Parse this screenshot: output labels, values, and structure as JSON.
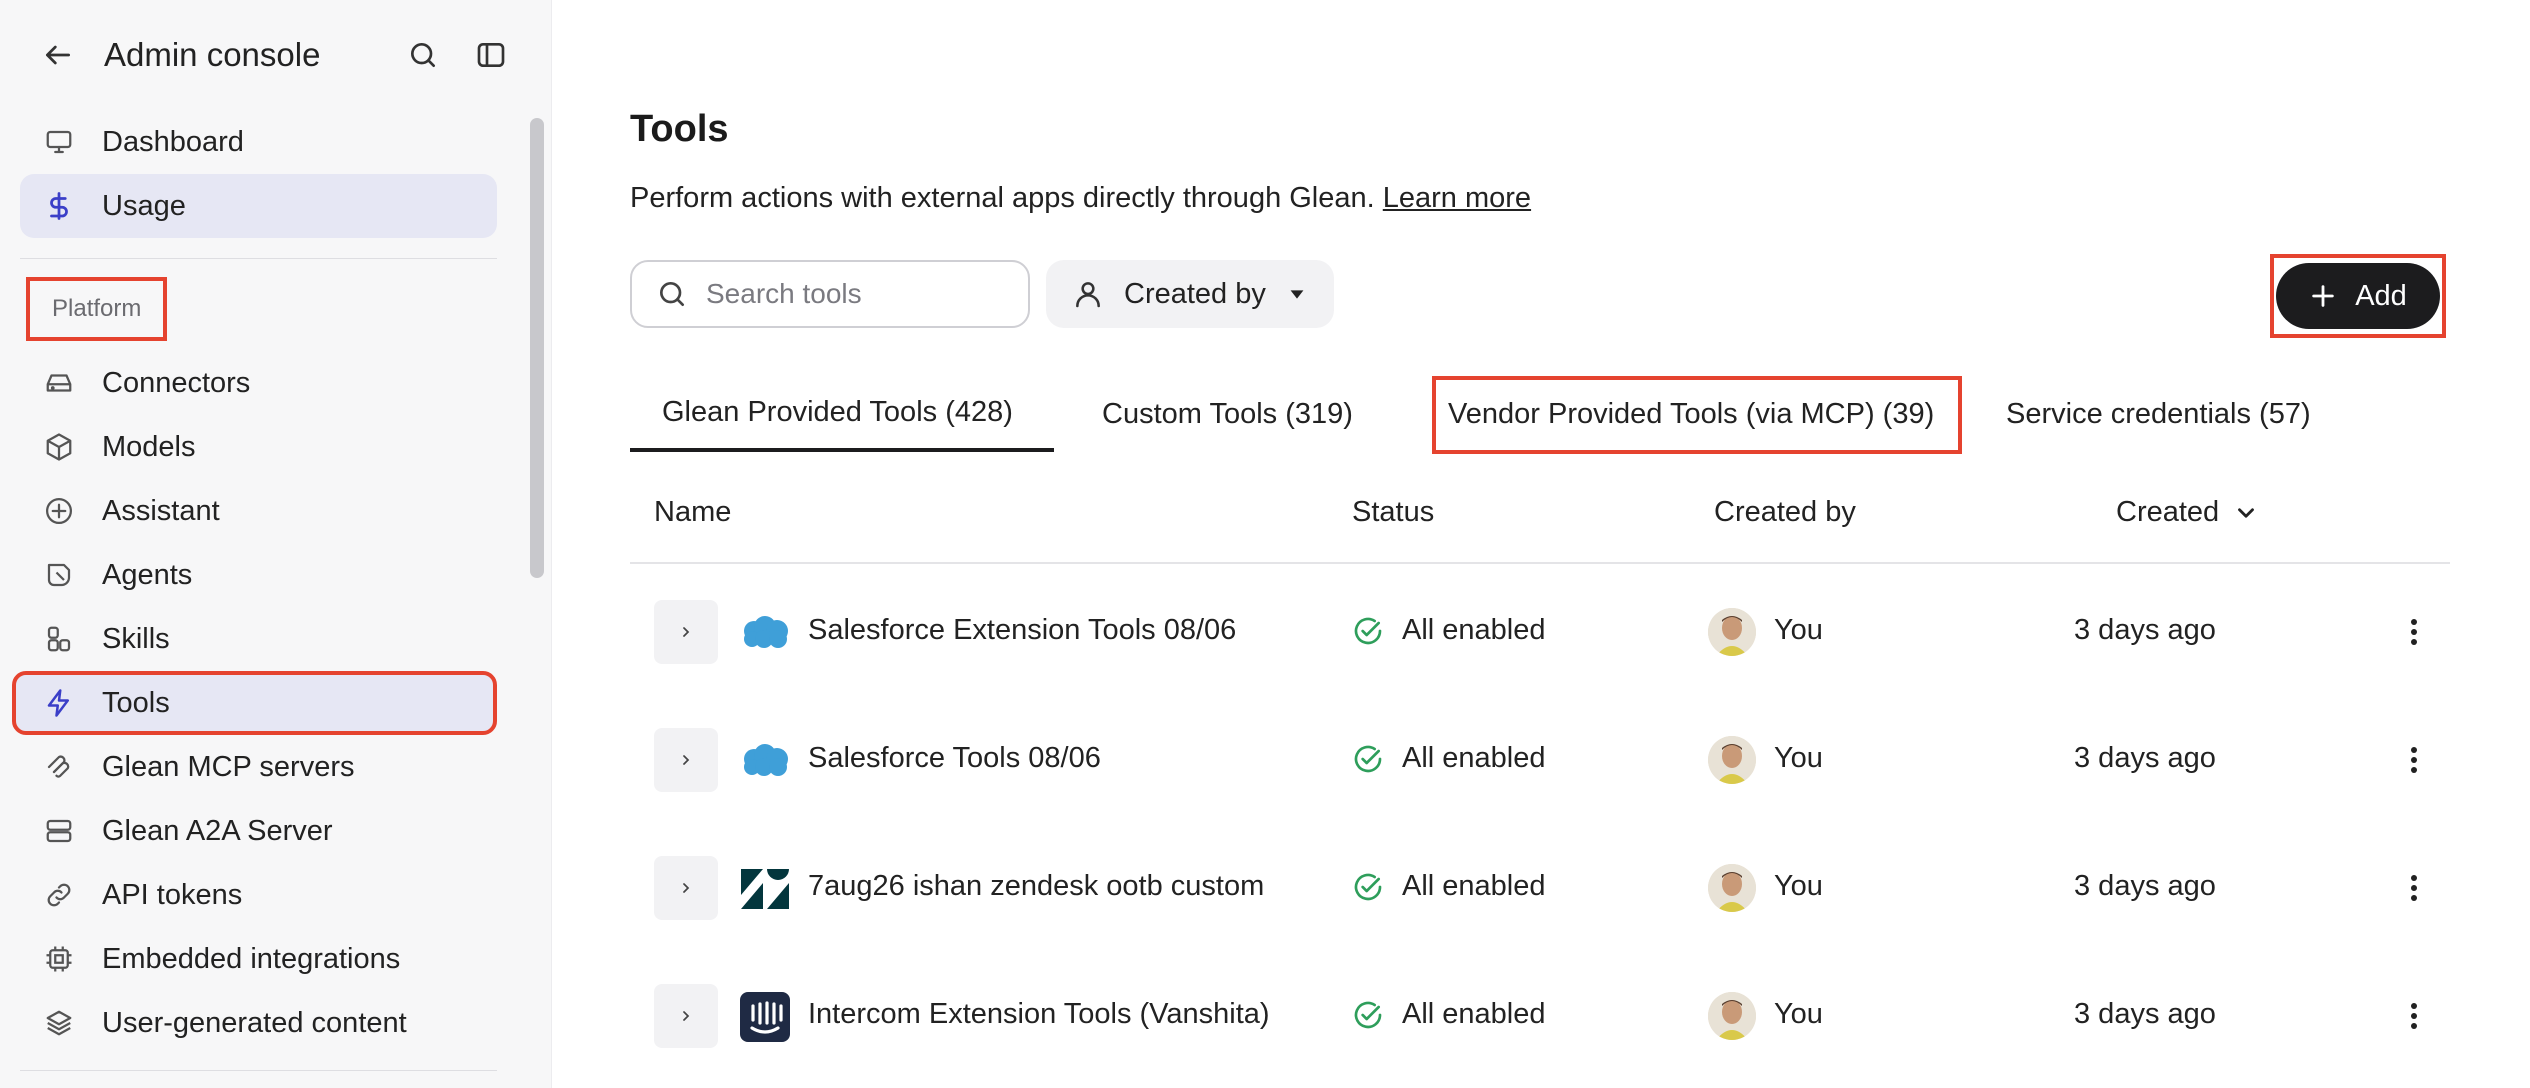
{
  "sidebar": {
    "title": "Admin console",
    "items_top": [
      {
        "label": "Dashboard",
        "icon": "monitor-icon"
      },
      {
        "label": "Usage",
        "icon": "dollar-icon",
        "active": true
      }
    ],
    "section_label": "Platform",
    "items": [
      {
        "label": "Connectors",
        "icon": "drive-icon"
      },
      {
        "label": "Models",
        "icon": "cube-icon"
      },
      {
        "label": "Assistant",
        "icon": "sparkle-icon"
      },
      {
        "label": "Agents",
        "icon": "agent-icon"
      },
      {
        "label": "Skills",
        "icon": "shapes-icon"
      },
      {
        "label": "Tools",
        "icon": "lightning-icon",
        "active": true
      },
      {
        "label": "Glean MCP servers",
        "icon": "mcp-icon"
      },
      {
        "label": "Glean A2A Server",
        "icon": "server-icon"
      },
      {
        "label": "API tokens",
        "icon": "link-icon"
      },
      {
        "label": "Embedded integrations",
        "icon": "chip-icon"
      },
      {
        "label": "User-generated content",
        "icon": "layers-icon"
      }
    ]
  },
  "main": {
    "title": "Tools",
    "subtitle": "Perform actions with external apps directly through Glean.",
    "learn_more": "Learn more",
    "search_placeholder": "Search tools",
    "filter_label": "Created by",
    "add_label": "Add",
    "tabs": [
      {
        "label": "Glean Provided Tools (428)",
        "active": true
      },
      {
        "label": "Custom Tools (319)"
      },
      {
        "label": "Vendor Provided Tools (via MCP) (39)"
      },
      {
        "label": "Service credentials (57)"
      }
    ],
    "columns": {
      "name": "Name",
      "status": "Status",
      "created_by": "Created by",
      "created": "Created"
    },
    "rows": [
      {
        "name": "Salesforce Extension Tools 08/06",
        "logo": "salesforce-logo-icon",
        "status": "All enabled",
        "created_by": "You",
        "created": "3 days ago"
      },
      {
        "name": "Salesforce Tools 08/06",
        "logo": "salesforce-logo-icon",
        "status": "All enabled",
        "created_by": "You",
        "created": "3 days ago"
      },
      {
        "name": "7aug26 ishan zendesk ootb custom",
        "logo": "zendesk-logo-icon",
        "status": "All enabled",
        "created_by": "You",
        "created": "3 days ago"
      },
      {
        "name": "Intercom Extension Tools (Vanshita)",
        "logo": "intercom-logo-icon",
        "status": "All enabled",
        "created_by": "You",
        "created": "3 days ago"
      }
    ]
  },
  "colors": {
    "accent": "#3b3fc8",
    "highlight": "#e5432f",
    "success": "#2e9e5b",
    "salesforce": "#3f9fd8",
    "zendesk": "#03363d",
    "intercom": "#1f2a44"
  }
}
